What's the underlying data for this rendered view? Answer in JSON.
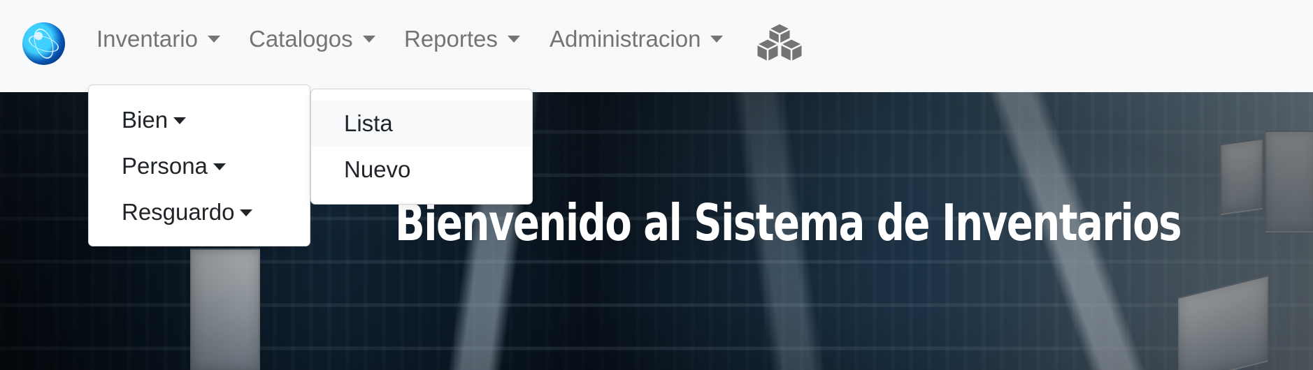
{
  "nav": {
    "items": [
      {
        "label": "Inventario"
      },
      {
        "label": "Catalogos"
      },
      {
        "label": "Reportes"
      },
      {
        "label": "Administracion"
      }
    ],
    "icons": {
      "brand": "globe-icon",
      "caret": "caret-down-icon",
      "inventory": "boxes-icon"
    }
  },
  "hero": {
    "title": "Bienvenido al Sistema de Inventarios"
  },
  "dropdowns": {
    "main": {
      "items": [
        {
          "label": "Bien"
        },
        {
          "label": "Persona"
        },
        {
          "label": "Resguardo"
        }
      ]
    },
    "submenu": {
      "items": [
        {
          "label": "Lista"
        },
        {
          "label": "Nuevo"
        }
      ]
    }
  },
  "colors": {
    "navbar": "#f8f9fa",
    "nav_text": "#747474",
    "menu_text": "#212529",
    "dropdown_bg": "#ffffff",
    "hover_bg": "#f8f9fa",
    "hero_text": "#ffffff"
  }
}
